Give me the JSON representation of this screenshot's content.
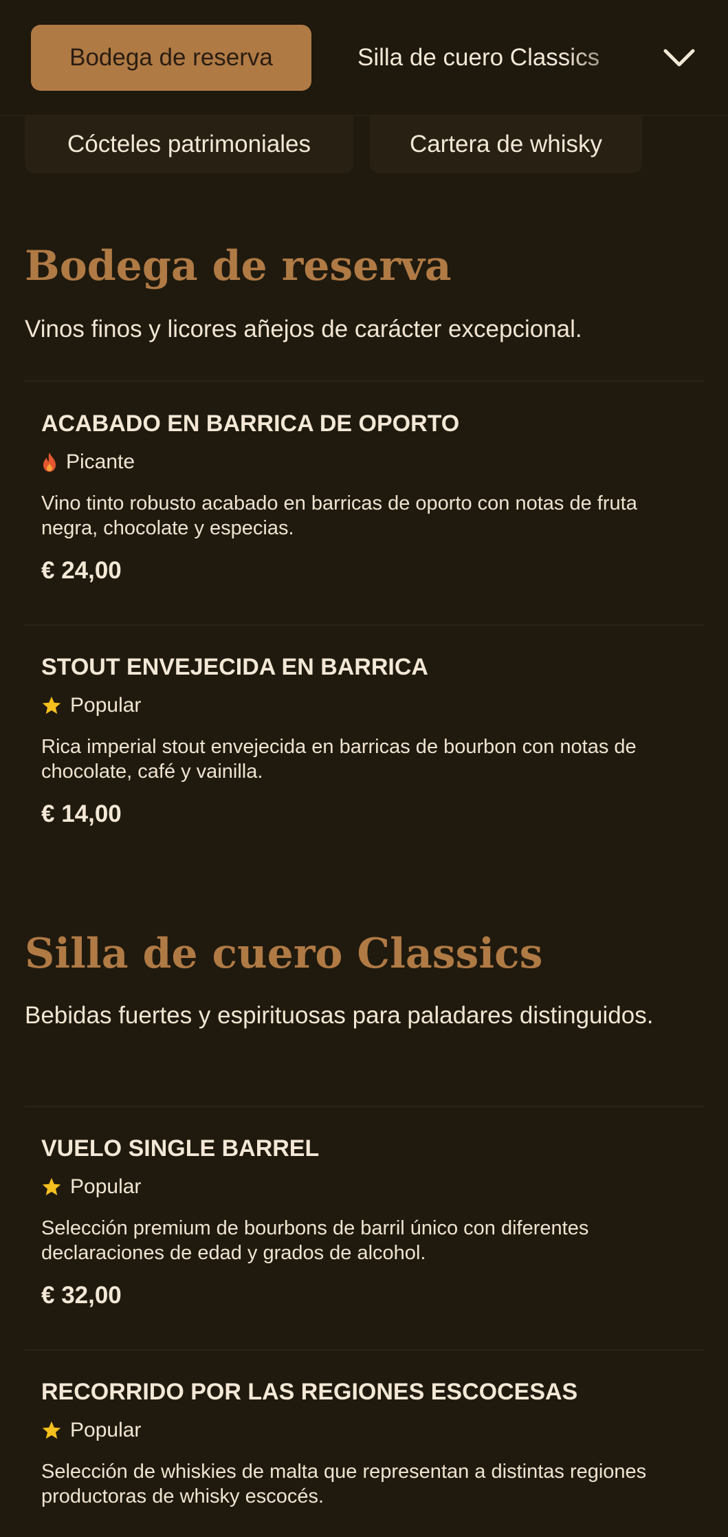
{
  "nav": {
    "active_category": "Bodega de reserva",
    "next_category": "Silla de cuero Classics",
    "pills": [
      "Cócteles patrimoniales",
      "Cartera de whisky"
    ],
    "expand_icon": "chevron-down-icon"
  },
  "colors": {
    "background": "#201a0e",
    "accent": "#b07a45",
    "spicy": "#e4572e",
    "popular": "#f4c01e"
  },
  "sections": [
    {
      "title": "Bodega de reserva",
      "description": "Vinos finos y licores añejos de carácter excepcional.",
      "items": [
        {
          "name": "ACABADO EN BARRICA DE OPORTO",
          "badge": "Picante",
          "badge_icon": "flame-icon",
          "description": "Vino tinto robusto acabado en barricas de oporto con notas de fruta negra, chocolate y especias.",
          "price": "€ 24,00"
        },
        {
          "name": "STOUT ENVEJECIDA EN BARRICA",
          "badge": "Popular",
          "badge_icon": "star-icon",
          "description": "Rica imperial stout envejecida en barricas de bourbon con notas de chocolate, café y vainilla.",
          "price": "€ 14,00"
        }
      ]
    },
    {
      "title": "Silla de cuero Classics",
      "description": "Bebidas fuertes y espirituosas para paladares distinguidos.",
      "items": [
        {
          "name": "VUELO SINGLE BARREL",
          "badge": "Popular",
          "badge_icon": "star-icon",
          "description": "Selección premium de bourbons de barril único con diferentes declaraciones de edad y grados de alcohol.",
          "price": "€ 32,00"
        },
        {
          "name": "RECORRIDO POR LAS REGIONES ESCOCESAS",
          "badge": "Popular",
          "badge_icon": "star-icon",
          "description": "Selección de whiskies de malta que representan a distintas regiones productoras de whisky escocés."
        }
      ]
    }
  ]
}
